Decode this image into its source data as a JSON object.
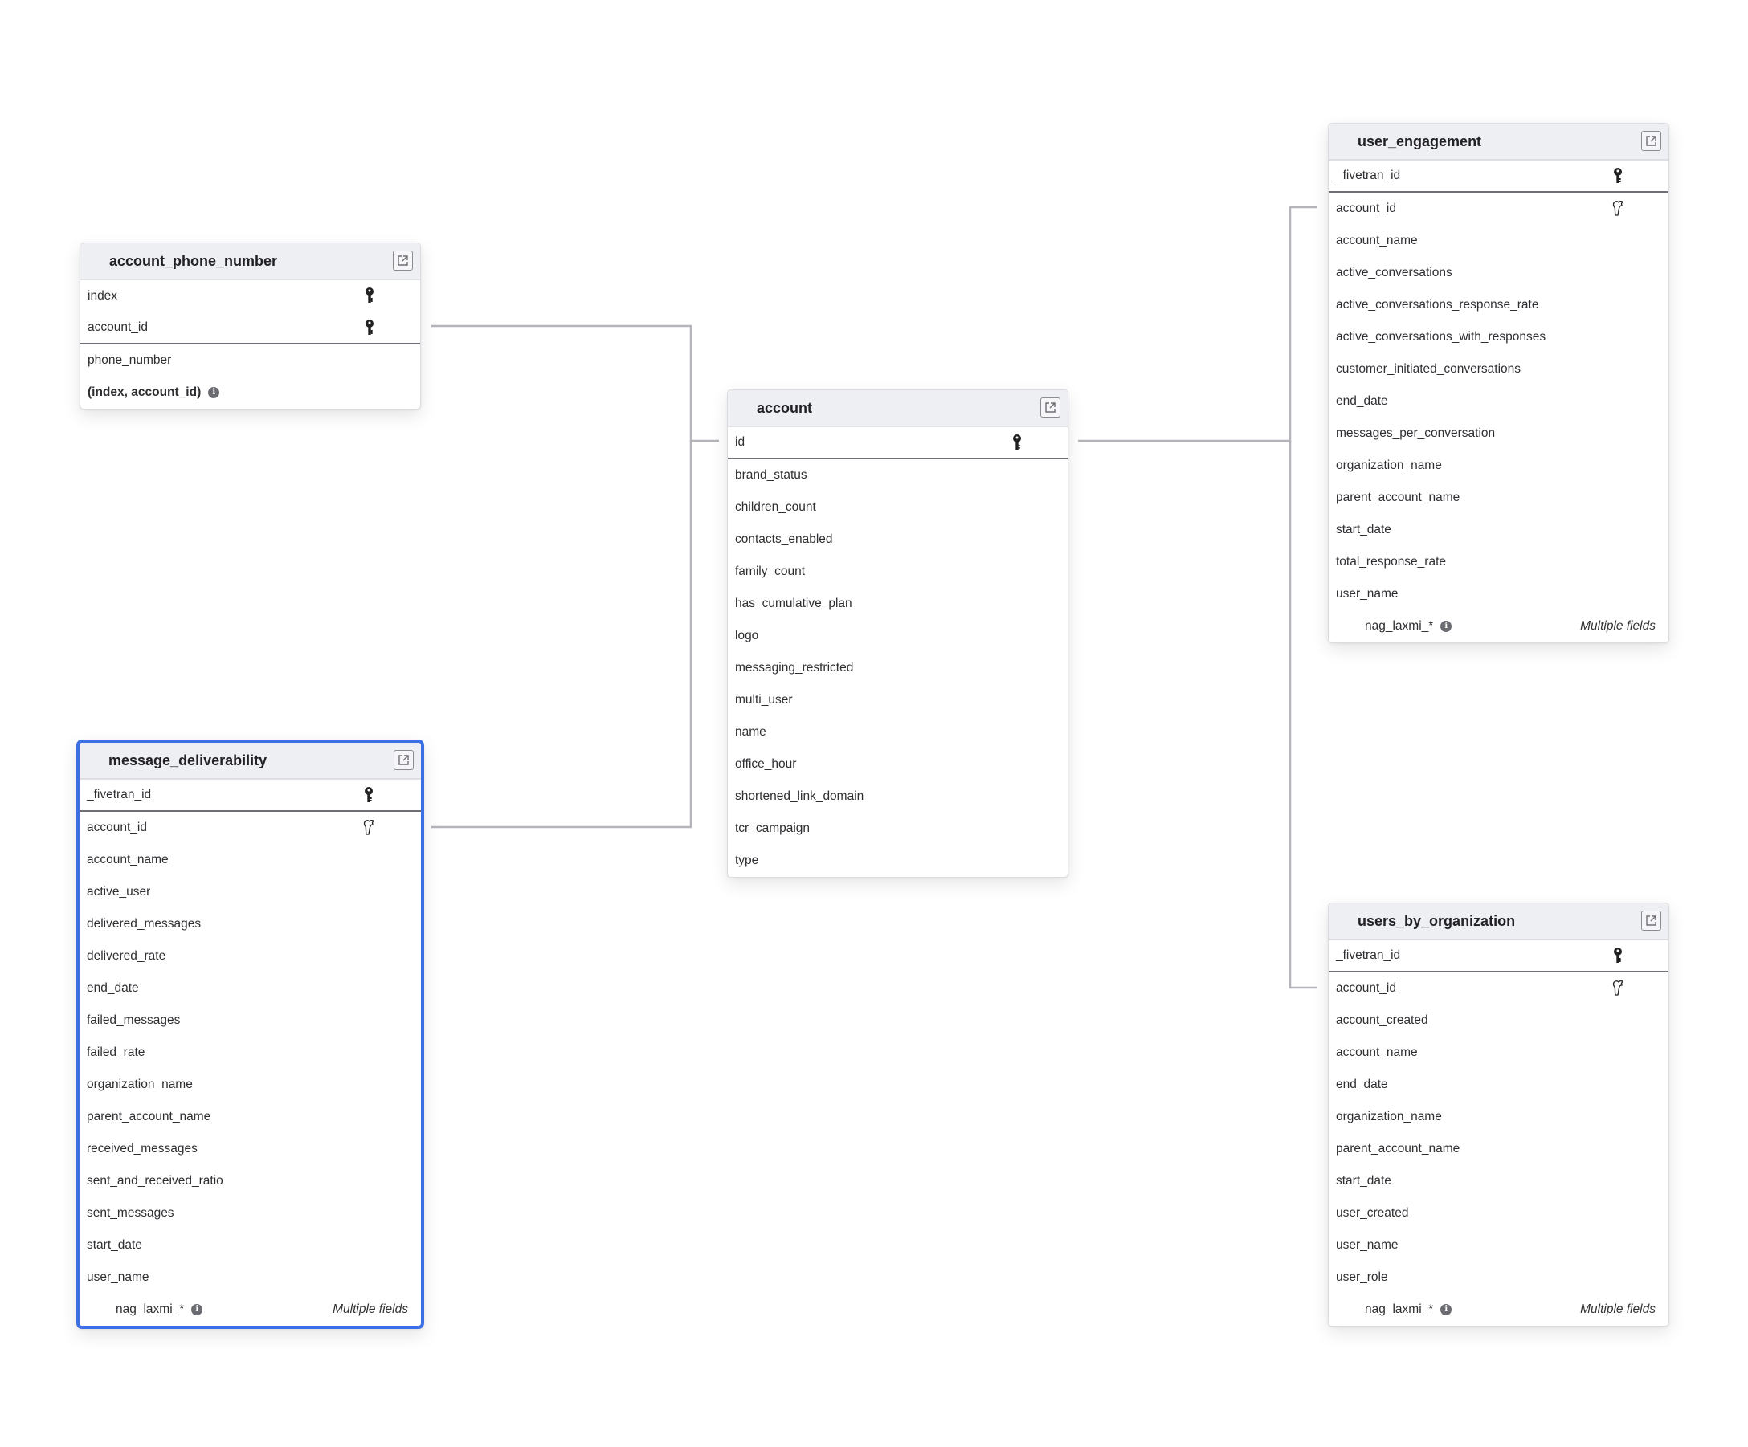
{
  "colors": {
    "selected_border": "#3b6fe3",
    "header_bg": "#eeeff2",
    "connector": "#b4b4ba"
  },
  "tables": {
    "account_phone_number": {
      "title": "account_phone_number",
      "fields": [
        {
          "name": "index",
          "icon": "primary-key-icon"
        },
        {
          "name": "account_id",
          "icon": "primary-key-icon"
        },
        {
          "name": "phone_number",
          "icon": null
        }
      ],
      "composite_key": "(index, account_id)"
    },
    "account": {
      "title": "account",
      "fields": [
        {
          "name": "id",
          "icon": "primary-key-icon"
        },
        {
          "name": "brand_status"
        },
        {
          "name": "children_count"
        },
        {
          "name": "contacts_enabled"
        },
        {
          "name": "family_count"
        },
        {
          "name": "has_cumulative_plan"
        },
        {
          "name": "logo"
        },
        {
          "name": "messaging_restricted"
        },
        {
          "name": "multi_user"
        },
        {
          "name": "name"
        },
        {
          "name": "office_hour"
        },
        {
          "name": "shortened_link_domain"
        },
        {
          "name": "tcr_campaign"
        },
        {
          "name": "type"
        }
      ]
    },
    "message_deliverability": {
      "title": "message_deliverability",
      "selected": true,
      "fields": [
        {
          "name": "_fivetran_id",
          "icon": "primary-key-icon"
        },
        {
          "name": "account_id",
          "icon": "foreign-key-icon"
        },
        {
          "name": "account_name"
        },
        {
          "name": "active_user"
        },
        {
          "name": "delivered_messages"
        },
        {
          "name": "delivered_rate"
        },
        {
          "name": "end_date"
        },
        {
          "name": "failed_messages"
        },
        {
          "name": "failed_rate"
        },
        {
          "name": "organization_name"
        },
        {
          "name": "parent_account_name"
        },
        {
          "name": "received_messages"
        },
        {
          "name": "sent_and_received_ratio"
        },
        {
          "name": "sent_messages"
        },
        {
          "name": "start_date"
        },
        {
          "name": "user_name"
        }
      ],
      "footer": {
        "label": "nag_laxmi_*",
        "right": "Multiple fields"
      }
    },
    "user_engagement": {
      "title": "user_engagement",
      "fields": [
        {
          "name": "_fivetran_id",
          "icon": "primary-key-icon"
        },
        {
          "name": "account_id",
          "icon": "foreign-key-icon"
        },
        {
          "name": "account_name"
        },
        {
          "name": "active_conversations"
        },
        {
          "name": "active_conversations_response_rate"
        },
        {
          "name": "active_conversations_with_responses"
        },
        {
          "name": "customer_initiated_conversations"
        },
        {
          "name": "end_date"
        },
        {
          "name": "messages_per_conversation"
        },
        {
          "name": "organization_name"
        },
        {
          "name": "parent_account_name"
        },
        {
          "name": "start_date"
        },
        {
          "name": "total_response_rate"
        },
        {
          "name": "user_name"
        }
      ],
      "footer": {
        "label": "nag_laxmi_*",
        "right": "Multiple fields"
      }
    },
    "users_by_organization": {
      "title": "users_by_organization",
      "fields": [
        {
          "name": "_fivetran_id",
          "icon": "primary-key-icon"
        },
        {
          "name": "account_id",
          "icon": "foreign-key-icon"
        },
        {
          "name": "account_created"
        },
        {
          "name": "account_name"
        },
        {
          "name": "end_date"
        },
        {
          "name": "organization_name"
        },
        {
          "name": "parent_account_name"
        },
        {
          "name": "start_date"
        },
        {
          "name": "user_created"
        },
        {
          "name": "user_name"
        },
        {
          "name": "user_role"
        }
      ],
      "footer": {
        "label": "nag_laxmi_*",
        "right": "Multiple fields"
      }
    }
  },
  "relationships": [
    {
      "from": "account_phone_number.account_id",
      "to": "account.id"
    },
    {
      "from": "message_deliverability.account_id",
      "to": "account.id"
    },
    {
      "from": "user_engagement.account_id",
      "to": "account.id"
    },
    {
      "from": "users_by_organization.account_id",
      "to": "account.id"
    }
  ]
}
